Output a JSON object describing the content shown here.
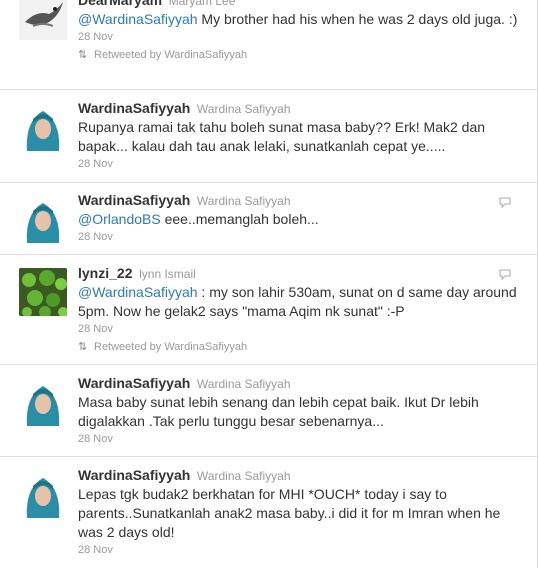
{
  "tweets": [
    {
      "screen_name": "DearMaryam",
      "full_name": "Maryam Lee",
      "mention": "@WardinaSafiyyah",
      "text": " My brother had his when he was 2 days old juga. :)",
      "time": "28 Nov",
      "retweet": "Retweeted by WardinaSafiyyah",
      "avatar": "bird-avatar"
    },
    {
      "screen_name": "WardinaSafiyyah",
      "full_name": "Wardina Safiyyah",
      "mention": "",
      "text": "Rupanya ramai tak tahu boleh sunat masa baby?? Erk! Mak2 dan bapak... kalau dah tau anak lelaki, sunatkanlah cepat ye.....",
      "time": "28 Nov",
      "avatar": "hijab-avatar"
    },
    {
      "screen_name": "WardinaSafiyyah",
      "full_name": "Wardina Safiyyah",
      "mention": "@OrlandoBS",
      "text": " eee..memanglah boleh...",
      "time": "28 Nov",
      "avatar": "hijab-avatar"
    },
    {
      "screen_name": "lynzi_22",
      "full_name": "lynn Ismail",
      "mention": "@WardinaSafiyyah",
      "text": " : my son lahir 530am, sunat on d same day around 5pm. Now he gelak2 says \"mama Aqim nk sunat\" :-P",
      "time": "28 Nov",
      "retweet": "Retweeted by WardinaSafiyyah",
      "avatar": "plant-avatar"
    },
    {
      "screen_name": "WardinaSafiyyah",
      "full_name": "Wardina Safiyyah",
      "mention": "",
      "text": "Masa baby sunat lebih senang dan lebih cepat baik. Ikut Dr lebih digalakkan .Tak perlu tunggu besar sebenarnya...",
      "time": "28 Nov",
      "avatar": "hijab-avatar"
    },
    {
      "screen_name": "WardinaSafiyyah",
      "full_name": "Wardina Safiyyah",
      "mention": "",
      "text": "Lepas tgk budak2 berkhatan for MHI *OUCH* today i say to parents..Sunatkanlah anak2 masa baby..i did it for m Imran when he was 2 days old!",
      "time": "28 Nov",
      "avatar": "hijab-avatar"
    }
  ],
  "colors": {
    "mention": "#2b7bb9",
    "meta_text": "#999999",
    "body_text": "#333333",
    "divider": "#e3e3e3"
  }
}
